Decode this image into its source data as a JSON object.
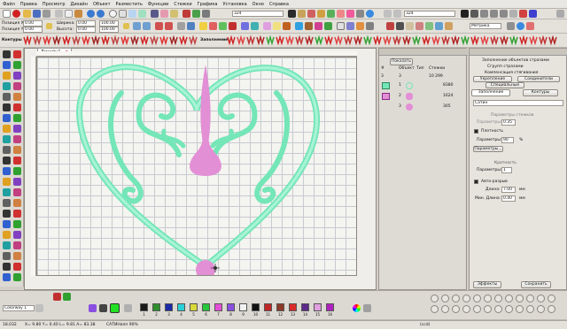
{
  "menu": [
    "Файл",
    "Правка",
    "Просмотр",
    "Дизайн",
    "Объект",
    "Разместить",
    "Функции",
    "Стежки",
    "Графика",
    "Установка",
    "Окно",
    "Справка"
  ],
  "toolbar1": {
    "combo_left": "324",
    "combo_right": "324"
  },
  "toolbar2": {
    "pos_x_label": "Позиция X:",
    "pos_x_value": "0.00",
    "pos_y_label": "Позиция Y:",
    "pos_y_value": "0.00",
    "width_label": "Ширина:",
    "width_value": "0.00",
    "height_label": "Высота:",
    "height_value": "0.00",
    "pct_w": "100.00",
    "pct_h": "100.00",
    "metrics_label": "Метрика"
  },
  "toolbar3": {
    "contours_label": "Контуры",
    "fills_label": "Заполнение"
  },
  "document": {
    "tab_title": "Дизайн1",
    "sub_tab_title": "Редактор",
    "heart_color": "#74e6b8",
    "motif_color": "#e28fd5"
  },
  "sequence": {
    "tab_label": "Показать",
    "header": [
      "#",
      "Объект",
      "Тип",
      "Стежки"
    ],
    "total_count": "3",
    "total_color_count": "3",
    "total_stitches": "10 299",
    "rows": [
      {
        "num": "1",
        "stitches": "8380"
      },
      {
        "num": "2",
        "stitches": "1624"
      },
      {
        "num": "3",
        "stitches": "305"
      }
    ]
  },
  "properties": {
    "menu": [
      "Заполнение объектов стразами",
      "Сгрупп стразами",
      "Компенсация стягивания"
    ],
    "tab_reinforce": "Укрепление",
    "tab_joins": "Соединители",
    "tab_special": "Специальные",
    "tab_fill": "Заполнение",
    "tab_contours": "Контуры",
    "fill_type": "Сатин",
    "params_heading": "Параметры стежков",
    "params_field_label": "Параметры:",
    "params_field_value": "0.35",
    "density_check": "Плотность",
    "density_label": "Параметры:",
    "density_value": "90",
    "density_unit": "%",
    "params_button": "Параметры...",
    "multiplicity_heading": "Кратность",
    "multiplicity_label": "Параметры:",
    "multiplicity_value": "1",
    "auto_split_check": "Авто-разрыв",
    "length_label": "Длина:",
    "length_value": "7.00",
    "min_length_label": "Мин. Длина:",
    "min_length_value": "0.40",
    "unit_mm": "мм",
    "effects_button": "Эффекты",
    "save_button": "Сохранить"
  },
  "palette": {
    "colorway_label": "Colorway 1",
    "swatches": [
      {
        "num": "1",
        "color": "#1a1a1a"
      },
      {
        "num": "2",
        "color": "#2f8f2f"
      },
      {
        "num": "3",
        "color": "#1c2aa8"
      },
      {
        "num": "4",
        "color": "#2bcfd6"
      },
      {
        "num": "5",
        "color": "#d8d83a"
      },
      {
        "num": "6",
        "color": "#28c63a"
      },
      {
        "num": "7",
        "color": "#e34fd6"
      },
      {
        "num": "8",
        "color": "#8a4fe0"
      },
      {
        "num": "9",
        "color": "#f2f2f2"
      },
      {
        "num": "10",
        "color": "#111111"
      },
      {
        "num": "11",
        "color": "#c02626"
      },
      {
        "num": "12",
        "color": "#8b3a2a"
      },
      {
        "num": "13",
        "color": "#d92a2a"
      },
      {
        "num": "14",
        "color": "#5a2a8a"
      },
      {
        "num": "15",
        "color": "#e0a0e0"
      },
      {
        "num": "16",
        "color": "#b020c0"
      }
    ],
    "selected_color": "#22e022"
  },
  "status": {
    "left": "18.032",
    "coords": "X=   9.80 Y=   0.40 L=   9.81 A=   83.38",
    "mode": "САТИНaпп 90%",
    "right_value": "(ccd)"
  }
}
